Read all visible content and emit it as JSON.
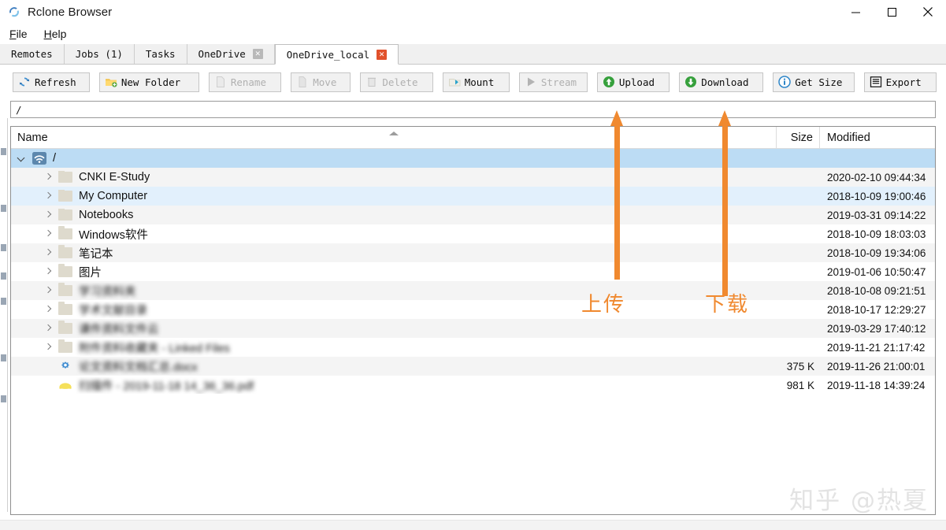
{
  "window": {
    "title": "Rclone Browser",
    "app_icon": "rclone-logo-icon",
    "minimize_label": "─",
    "maximize_label": "□",
    "close_label": "✕"
  },
  "menubar": {
    "items": [
      {
        "label": "File",
        "mnemonic": "F",
        "rest": "ile"
      },
      {
        "label": "Help",
        "mnemonic": "H",
        "rest": "elp"
      }
    ]
  },
  "tabs": [
    {
      "label": "Remotes",
      "active": false,
      "closable": false
    },
    {
      "label": "Jobs (1)",
      "active": false,
      "closable": false
    },
    {
      "label": "Tasks",
      "active": false,
      "closable": false
    },
    {
      "label": "OneDrive",
      "active": false,
      "closable": true,
      "close_label": "✕"
    },
    {
      "label": "OneDrive_local",
      "active": true,
      "closable": true,
      "close_label": "✕"
    }
  ],
  "toolbar": {
    "buttons": [
      {
        "label": "Refresh",
        "icon": "refresh-icon",
        "enabled": true,
        "width_class": "w-refresh"
      },
      {
        "label": "New Folder",
        "icon": "new-folder-icon",
        "enabled": true,
        "width_class": "w-newfolder"
      },
      {
        "label": "Rename",
        "icon": "rename-icon",
        "enabled": false,
        "width_class": "w-rename"
      },
      {
        "label": "Move",
        "icon": "move-icon",
        "enabled": false,
        "width_class": "w-move"
      },
      {
        "label": "Delete",
        "icon": "delete-icon",
        "enabled": false,
        "width_class": "w-delete"
      },
      {
        "label": "Mount",
        "icon": "mount-icon",
        "enabled": true,
        "width_class": "w-mount"
      },
      {
        "label": "Stream",
        "icon": "stream-icon",
        "enabled": false,
        "width_class": "w-stream"
      },
      {
        "label": "Upload",
        "icon": "upload-icon",
        "enabled": true,
        "width_class": "w-upload"
      },
      {
        "label": "Download",
        "icon": "download-icon",
        "enabled": true,
        "width_class": "w-download"
      },
      {
        "label": "Get Size",
        "icon": "info-icon",
        "enabled": true,
        "width_class": "w-getsize"
      },
      {
        "label": "Export",
        "icon": "export-icon",
        "enabled": true,
        "width_class": "w-export"
      }
    ]
  },
  "path": {
    "value": "/"
  },
  "filelist": {
    "columns": {
      "name": "Name",
      "size": "Size",
      "modified": "Modified"
    },
    "sort": {
      "column": "Name",
      "direction": "ascending"
    },
    "rows": [
      {
        "name": "/",
        "indent": 0,
        "icon": "remote-cloud-icon",
        "twisty": "down",
        "size": "",
        "modified": "",
        "state": "sel",
        "blurred": false
      },
      {
        "name": "CNKI E-Study",
        "indent": 1,
        "icon": "folder-icon",
        "twisty": "right",
        "size": "",
        "modified": "2020-02-10 09:44:34",
        "state": "alt",
        "blurred": false
      },
      {
        "name": "My Computer",
        "indent": 1,
        "icon": "folder-icon",
        "twisty": "right",
        "size": "",
        "modified": "2018-10-09 19:00:46",
        "state": "soft",
        "blurred": false
      },
      {
        "name": "Notebooks",
        "indent": 1,
        "icon": "folder-icon",
        "twisty": "right",
        "size": "",
        "modified": "2019-03-31 09:14:22",
        "state": "alt",
        "blurred": false
      },
      {
        "name": "Windows软件",
        "indent": 1,
        "icon": "folder-icon",
        "twisty": "right",
        "size": "",
        "modified": "2018-10-09 18:03:03",
        "state": "white",
        "blurred": false
      },
      {
        "name": "笔记本",
        "indent": 1,
        "icon": "folder-icon",
        "twisty": "right",
        "size": "",
        "modified": "2018-10-09 19:34:06",
        "state": "alt",
        "blurred": false
      },
      {
        "name": "图片",
        "indent": 1,
        "icon": "folder-icon",
        "twisty": "right",
        "size": "",
        "modified": "2019-01-06 10:50:47",
        "state": "white",
        "blurred": false
      },
      {
        "name": "学习资料夹",
        "indent": 1,
        "icon": "folder-icon",
        "twisty": "right",
        "size": "",
        "modified": "2018-10-08 09:21:51",
        "state": "alt",
        "blurred": true
      },
      {
        "name": "学术文献目录",
        "indent": 1,
        "icon": "folder-icon",
        "twisty": "right",
        "size": "",
        "modified": "2018-10-17 12:29:27",
        "state": "white",
        "blurred": true
      },
      {
        "name": "课件资料文件云",
        "indent": 1,
        "icon": "folder-icon",
        "twisty": "right",
        "size": "",
        "modified": "2019-03-29 17:40:12",
        "state": "alt",
        "blurred": true
      },
      {
        "name": "附件资料收藏夹 - Linked Files",
        "indent": 1,
        "icon": "folder-icon",
        "twisty": "right",
        "size": "",
        "modified": "2019-11-21 21:17:42",
        "state": "white",
        "blurred": true
      },
      {
        "name": "论文资料文档汇总.docx",
        "indent": 1,
        "icon": "docx-file-icon",
        "twisty": "none",
        "size": "375 K",
        "modified": "2019-11-26 21:00:01",
        "state": "alt",
        "blurred": true
      },
      {
        "name": "扫描件 - 2019-11-18 14_36_36.pdf",
        "indent": 1,
        "icon": "pdf-file-icon",
        "twisty": "none",
        "size": "981 K",
        "modified": "2019-11-18 14:39:24",
        "state": "white",
        "blurred": true
      }
    ]
  },
  "annotations": {
    "color": "#f0892f",
    "upload": {
      "label": "上传"
    },
    "download": {
      "label": "下载"
    }
  },
  "watermark": {
    "text": "知乎 @热夏"
  }
}
